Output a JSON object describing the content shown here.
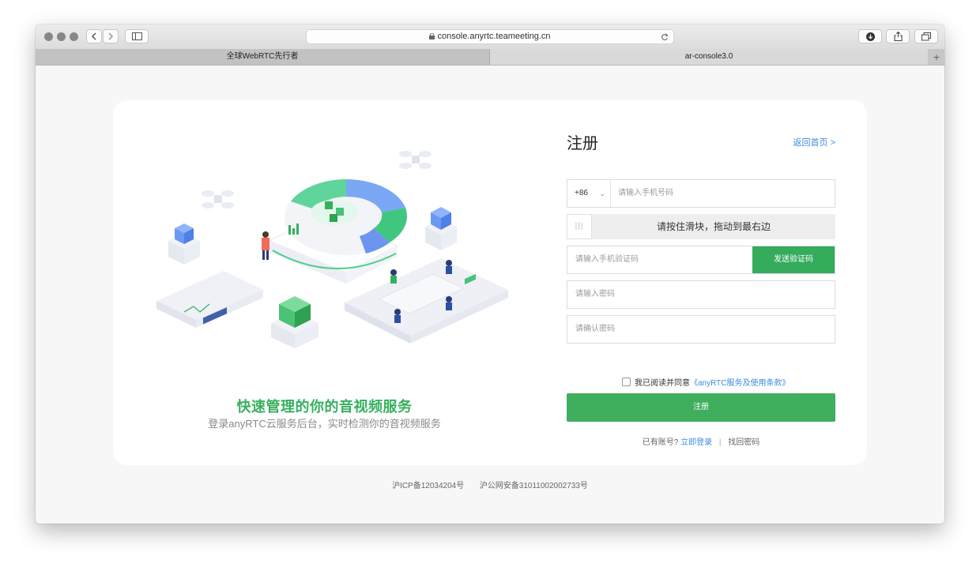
{
  "browser": {
    "url": "console.anyrtc.teameeting.cn",
    "tabs": [
      {
        "label": "全球WebRTC先行者",
        "active": false
      },
      {
        "label": "ar-console3.0",
        "active": true
      }
    ]
  },
  "illustration": {
    "headline": "快速管理的你的音视频服务",
    "subline": "登录anyRTC云服务后台，实时检测你的音视频服务"
  },
  "form": {
    "title": "注册",
    "back_home": "返回首页 >",
    "country_code": "+86",
    "phone_placeholder": "请输入手机号码",
    "slider_text": "请按住滑块，拖动到最右边",
    "sms_code_placeholder": "请输入手机验证码",
    "send_code_label": "发送验证码",
    "password_placeholder": "请输入密码",
    "confirm_password_placeholder": "请确认密码",
    "agree_prefix": "我已阅读并同意",
    "agree_link": "《anyRTC服务及使用条款》",
    "submit_label": "注册",
    "have_account": "已有账号?",
    "login_link": "立即登录",
    "divider": "|",
    "find_password": "找回密码"
  },
  "footer": {
    "icp": "沪ICP备12034204号",
    "police": "沪公网安备31011002002733号"
  },
  "colors": {
    "brand_green": "#35ab5c",
    "link_blue": "#3b8be0"
  }
}
